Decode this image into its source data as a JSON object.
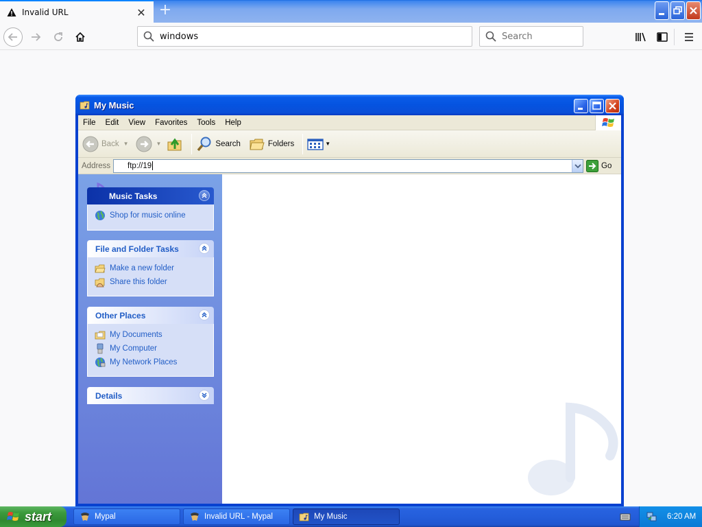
{
  "browser": {
    "tab_title": "Invalid URL",
    "url": "windows",
    "search_placeholder": "Search"
  },
  "explorer": {
    "title": "My Music",
    "menu": [
      "File",
      "Edit",
      "View",
      "Favorites",
      "Tools",
      "Help"
    ],
    "toolbar": {
      "back": "Back",
      "search": "Search",
      "folders": "Folders"
    },
    "address": {
      "label": "Address",
      "value": "ftp://19",
      "go": "Go"
    },
    "task_pane": {
      "music_tasks": {
        "title": "Music Tasks",
        "links": [
          "Shop for music online"
        ]
      },
      "file_folder_tasks": {
        "title": "File and Folder Tasks",
        "links": [
          "Make a new folder",
          "Share this folder"
        ]
      },
      "other_places": {
        "title": "Other Places",
        "links": [
          "My Documents",
          "My Computer",
          "My Network Places"
        ]
      },
      "details": {
        "title": "Details"
      }
    }
  },
  "taskbar": {
    "start": "start",
    "items": [
      {
        "label": "Mypal",
        "active": false
      },
      {
        "label": "Invalid URL - Mypal",
        "active": false
      },
      {
        "label": "My Music",
        "active": true
      }
    ],
    "clock": "6:20 AM"
  }
}
